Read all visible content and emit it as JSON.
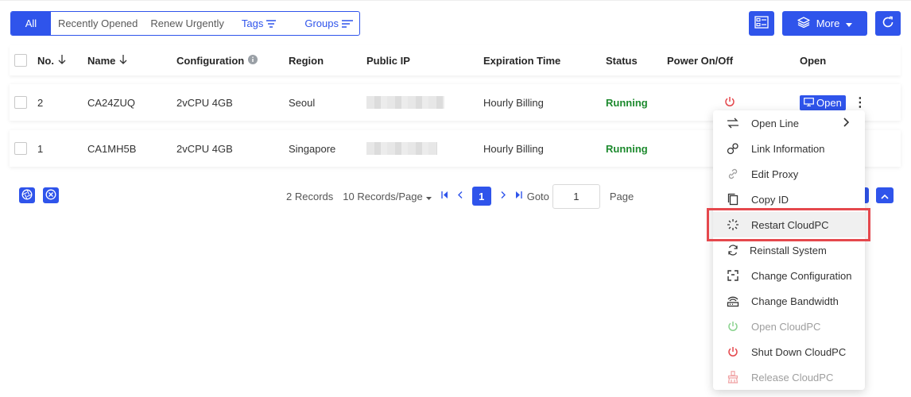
{
  "filters": {
    "all": "All",
    "recent": "Recently Opened",
    "renew": "Renew Urgently",
    "tags": "Tags",
    "groups": "Groups"
  },
  "toolbar": {
    "more_label": "More"
  },
  "table": {
    "headers": {
      "no": "No.",
      "name": "Name",
      "configuration": "Configuration",
      "region": "Region",
      "public_ip": "Public IP",
      "expiration": "Expiration Time",
      "status": "Status",
      "power": "Power On/Off",
      "open": "Open"
    },
    "rows": [
      {
        "no": "2",
        "name": "CA24ZUQ",
        "config": "2vCPU 4GB",
        "region": "Seoul",
        "expiration": "Hourly Billing",
        "status": "Running",
        "open_label": "Open"
      },
      {
        "no": "1",
        "name": "CA1MH5B",
        "config": "2vCPU 4GB",
        "region": "Singapore",
        "expiration": "Hourly Billing",
        "status": "Running"
      }
    ]
  },
  "pagination": {
    "records": "2 Records",
    "per_page": "10 Records/Page",
    "current_page": "1",
    "goto_label": "Goto",
    "goto_value": "1",
    "page_label": "Page"
  },
  "menu": {
    "items": [
      {
        "label": "Open Line",
        "icon": "route-icon"
      },
      {
        "label": "Link Information",
        "icon": "link-info-icon"
      },
      {
        "label": "Edit Proxy",
        "icon": "proxy-link-icon"
      },
      {
        "label": "Copy ID",
        "icon": "copy-icon"
      },
      {
        "label": "Restart CloudPC",
        "icon": "restart-spinner-icon"
      },
      {
        "label": "Reinstall System",
        "icon": "reinstall-icon"
      },
      {
        "label": "Change Configuration",
        "icon": "config-icon"
      },
      {
        "label": "Change Bandwidth",
        "icon": "bandwidth-icon"
      },
      {
        "label": "Open CloudPC",
        "icon": "power-icon"
      },
      {
        "label": "Shut Down CloudPC",
        "icon": "power-icon"
      },
      {
        "label": "Release CloudPC",
        "icon": "broom-icon"
      }
    ]
  },
  "colors": {
    "primary": "#2f54eb",
    "running": "#1d8a2e",
    "danger": "#e5484d",
    "disabled_green": "#8bd38f"
  }
}
